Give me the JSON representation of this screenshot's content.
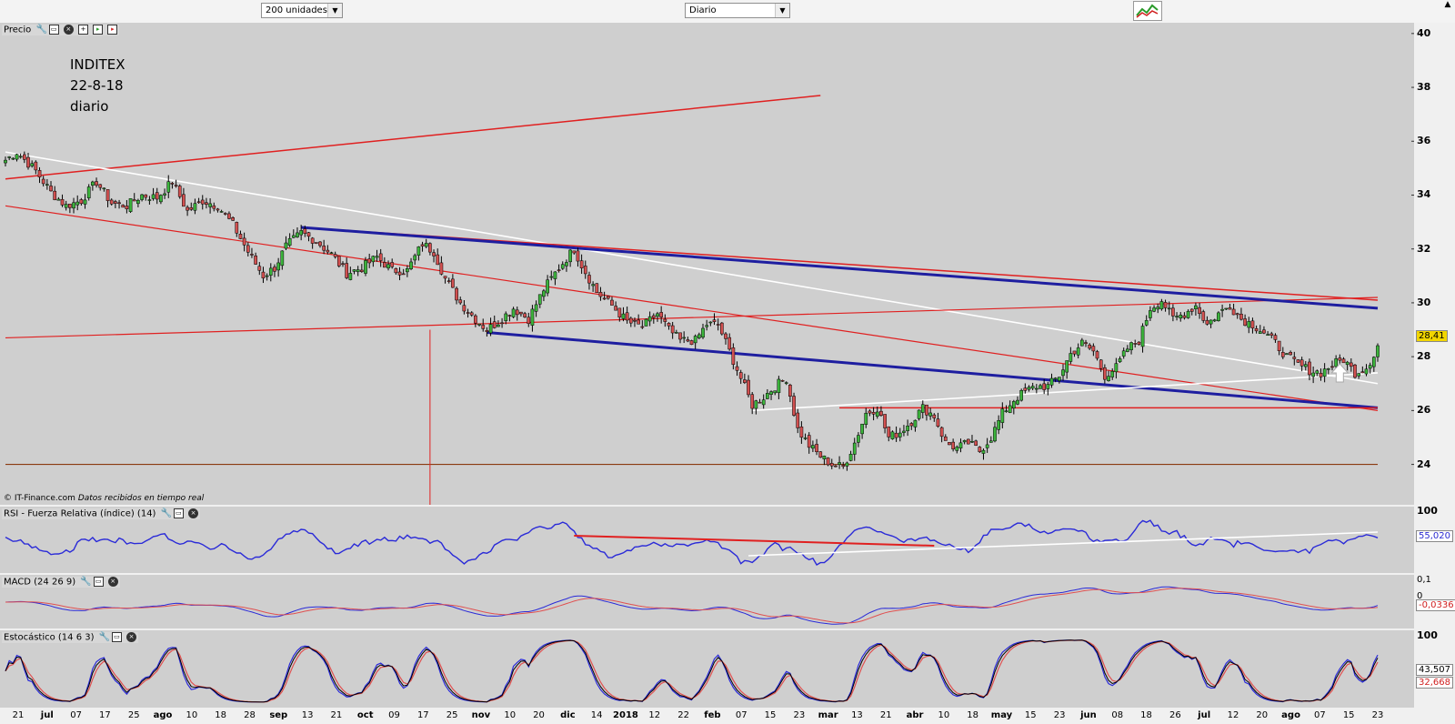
{
  "toolbar": {
    "range_select": "200 unidades",
    "interval_select": "Diario",
    "tool_icon": "strategy-chart-icon"
  },
  "price_panel": {
    "title": "Precio",
    "note_lines": [
      "INDITEX",
      "22-8-18",
      "diario"
    ],
    "credit": "© IT-Finance.com",
    "credit_italic": "Datos recibidos en tiempo real",
    "y_ticks": [
      "40",
      "38",
      "36",
      "34",
      "32",
      "30",
      "28",
      "26",
      "24"
    ],
    "last_value": "28,41",
    "last_badge_color": "#f2d600"
  },
  "rsi_panel": {
    "title": "RSI - Fuerza Relativa (índice) (14)",
    "y_ticks": [
      "100"
    ],
    "last_value": "55,020"
  },
  "macd_panel": {
    "title": "MACD (24 26 9)",
    "y_ticks": [
      "0,1",
      "0"
    ],
    "last_value": "-0,0336"
  },
  "stoch_panel": {
    "title": "Estocástico (14 6 3)",
    "y_ticks": [
      "100"
    ],
    "last_value_k": "43,507",
    "last_value_d": "32,668"
  },
  "x_axis": {
    "labels": [
      {
        "t": "21",
        "b": false
      },
      {
        "t": "jul",
        "b": true
      },
      {
        "t": "07",
        "b": false
      },
      {
        "t": "17",
        "b": false
      },
      {
        "t": "25",
        "b": false
      },
      {
        "t": "ago",
        "b": true
      },
      {
        "t": "10",
        "b": false
      },
      {
        "t": "18",
        "b": false
      },
      {
        "t": "28",
        "b": false
      },
      {
        "t": "sep",
        "b": true
      },
      {
        "t": "13",
        "b": false
      },
      {
        "t": "21",
        "b": false
      },
      {
        "t": "oct",
        "b": true
      },
      {
        "t": "09",
        "b": false
      },
      {
        "t": "17",
        "b": false
      },
      {
        "t": "25",
        "b": false
      },
      {
        "t": "nov",
        "b": true
      },
      {
        "t": "10",
        "b": false
      },
      {
        "t": "20",
        "b": false
      },
      {
        "t": "dic",
        "b": true
      },
      {
        "t": "14",
        "b": false
      },
      {
        "t": "2018",
        "b": true
      },
      {
        "t": "12",
        "b": false
      },
      {
        "t": "22",
        "b": false
      },
      {
        "t": "feb",
        "b": true
      },
      {
        "t": "07",
        "b": false
      },
      {
        "t": "15",
        "b": false
      },
      {
        "t": "23",
        "b": false
      },
      {
        "t": "mar",
        "b": true
      },
      {
        "t": "13",
        "b": false
      },
      {
        "t": "21",
        "b": false
      },
      {
        "t": "abr",
        "b": true
      },
      {
        "t": "10",
        "b": false
      },
      {
        "t": "18",
        "b": false
      },
      {
        "t": "may",
        "b": true
      },
      {
        "t": "15",
        "b": false
      },
      {
        "t": "23",
        "b": false
      },
      {
        "t": "jun",
        "b": true
      },
      {
        "t": "08",
        "b": false
      },
      {
        "t": "18",
        "b": false
      },
      {
        "t": "26",
        "b": false
      },
      {
        "t": "jul",
        "b": true
      },
      {
        "t": "12",
        "b": false
      },
      {
        "t": "20",
        "b": false
      },
      {
        "t": "ago",
        "b": true
      },
      {
        "t": "07",
        "b": false
      },
      {
        "t": "15",
        "b": false
      },
      {
        "t": "23",
        "b": false
      }
    ]
  },
  "chart_data": {
    "type": "candlestick",
    "ylim": [
      22.5,
      40.4
    ],
    "anchors": [
      [
        0,
        35.3
      ],
      [
        3,
        35.6
      ],
      [
        8,
        34.9
      ],
      [
        12,
        34.1
      ],
      [
        16,
        33.6
      ],
      [
        20,
        33.8
      ],
      [
        24,
        34.5
      ],
      [
        28,
        33.7
      ],
      [
        32,
        33.6
      ],
      [
        36,
        34.0
      ],
      [
        40,
        33.9
      ],
      [
        44,
        34.5
      ],
      [
        48,
        33.4
      ],
      [
        52,
        33.8
      ],
      [
        56,
        33.6
      ],
      [
        60,
        32.9
      ],
      [
        64,
        31.9
      ],
      [
        68,
        31.0
      ],
      [
        71,
        31.3
      ],
      [
        74,
        32.1
      ],
      [
        78,
        32.6
      ],
      [
        82,
        32.3
      ],
      [
        86,
        31.8
      ],
      [
        90,
        31.1
      ],
      [
        94,
        31.3
      ],
      [
        98,
        31.7
      ],
      [
        102,
        31.2
      ],
      [
        106,
        31.2
      ],
      [
        110,
        32.2
      ],
      [
        113,
        31.9
      ],
      [
        116,
        30.9
      ],
      [
        120,
        30.0
      ],
      [
        124,
        29.4
      ],
      [
        127,
        29.0
      ],
      [
        130,
        29.3
      ],
      [
        134,
        29.8
      ],
      [
        138,
        29.4
      ],
      [
        142,
        30.5
      ],
      [
        146,
        31.3
      ],
      [
        150,
        32.0
      ],
      [
        152,
        31.4
      ],
      [
        156,
        30.4
      ],
      [
        160,
        29.9
      ],
      [
        164,
        29.3
      ],
      [
        168,
        29.1
      ],
      [
        172,
        29.6
      ],
      [
        175,
        29.0
      ],
      [
        178,
        28.6
      ],
      [
        182,
        28.6
      ],
      [
        185,
        29.2
      ],
      [
        188,
        29.2
      ],
      [
        191,
        28.2
      ],
      [
        194,
        27.2
      ],
      [
        197,
        26.2
      ],
      [
        200,
        26.5
      ],
      [
        203,
        26.9
      ],
      [
        206,
        27.2
      ],
      [
        209,
        25.3
      ],
      [
        212,
        24.7
      ],
      [
        215,
        24.3
      ],
      [
        218,
        24.0
      ],
      [
        221,
        23.9
      ],
      [
        224,
        24.8
      ],
      [
        227,
        25.9
      ],
      [
        230,
        26.1
      ],
      [
        233,
        25.0
      ],
      [
        236,
        25.2
      ],
      [
        239,
        25.6
      ],
      [
        242,
        26.1
      ],
      [
        245,
        25.8
      ],
      [
        248,
        24.8
      ],
      [
        251,
        24.6
      ],
      [
        254,
        24.8
      ],
      [
        257,
        24.5
      ],
      [
        260,
        25.0
      ],
      [
        263,
        25.9
      ],
      [
        266,
        26.4
      ],
      [
        269,
        26.7
      ],
      [
        272,
        26.9
      ],
      [
        275,
        26.9
      ],
      [
        278,
        27.3
      ],
      [
        281,
        28.1
      ],
      [
        284,
        28.5
      ],
      [
        287,
        28.2
      ],
      [
        290,
        27.3
      ],
      [
        293,
        27.6
      ],
      [
        296,
        28.3
      ],
      [
        299,
        28.6
      ],
      [
        302,
        29.8
      ],
      [
        305,
        30.1
      ],
      [
        308,
        29.4
      ],
      [
        311,
        29.6
      ],
      [
        314,
        29.9
      ],
      [
        317,
        29.2
      ],
      [
        320,
        29.6
      ],
      [
        323,
        29.9
      ],
      [
        326,
        29.4
      ],
      [
        329,
        29.2
      ],
      [
        332,
        28.9
      ],
      [
        335,
        28.5
      ],
      [
        338,
        28.0
      ],
      [
        341,
        27.7
      ],
      [
        344,
        27.5
      ],
      [
        347,
        27.4
      ],
      [
        350,
        27.7
      ],
      [
        353,
        27.9
      ],
      [
        356,
        27.4
      ],
      [
        359,
        27.6
      ],
      [
        362,
        28.3
      ]
    ],
    "bars": 363,
    "color_up": "#3cb43c",
    "color_down": "#d25050"
  }
}
